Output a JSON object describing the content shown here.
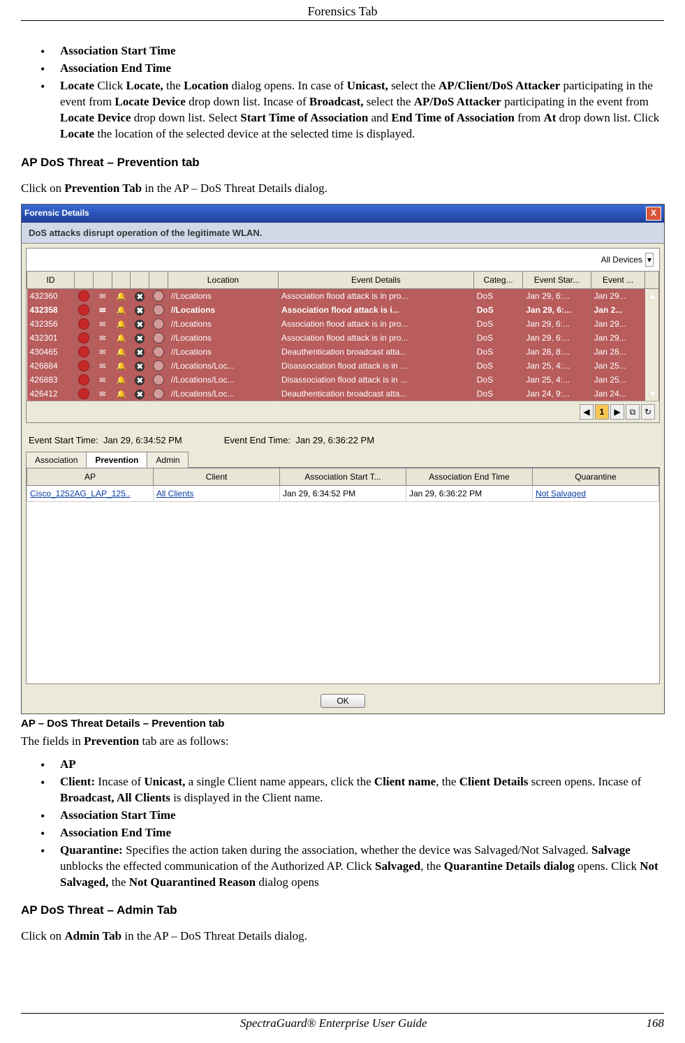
{
  "header": {
    "title": "Forensics Tab"
  },
  "bullets_top": [
    {
      "html": "<span class='bold'>Association Start Time</span>"
    },
    {
      "html": "<span class='bold'>Association End Time</span>"
    },
    {
      "html": "<span class='bold'>Locate</span> Click <span class='bold'>Locate,</span> the <span class='bold'>Location</span> dialog opens. In case of <span class='bold'>Unicast,</span> select the <span class='bold'>AP/Client/DoS Attacker</span> participating in the event from <span class='bold'>Locate Device</span> drop down list. Incase of <span class='bold'>Broadcast,</span> select the <span class='bold'>AP/DoS Attacker</span> participating in the event from <span class='bold'>Locate Device</span> drop down list. Select <span class='bold'>Start Time of Association</span> and <span class='bold'>End Time of Association</span> from <span class='bold'>At</span> drop down list. Click <span class='bold'>Locate</span> the location of the selected device at the selected time is displayed."
    }
  ],
  "section1": {
    "heading": "AP DoS Threat – Prevention tab",
    "lead_html": "Click on <span class='bold'>Prevention Tab</span> in the AP – DoS Threat Details dialog."
  },
  "dialog": {
    "title": "Forensic Details",
    "close": "X",
    "strip": "DoS attacks disrupt operation of the legitimate WLAN.",
    "filter_label": "All Devices",
    "columns": [
      "ID",
      "",
      "",
      "",
      "",
      "",
      "Location",
      "Event Details",
      "Categ...",
      "Event Star...",
      "Event ..."
    ],
    "rows": [
      {
        "id": "432360",
        "loc": "//Locations",
        "ev": "Association flood attack is in pro...",
        "cat": "DoS",
        "st": "Jan 29, 6:...",
        "en": "Jan 29...",
        "bold": false
      },
      {
        "id": "432358",
        "loc": "//Locations",
        "ev": "Association flood attack is i...",
        "cat": "DoS",
        "st": "Jan 29, 6:...",
        "en": "Jan 2...",
        "bold": true
      },
      {
        "id": "432356",
        "loc": "//Locations",
        "ev": "Association flood attack is in pro...",
        "cat": "DoS",
        "st": "Jan 29, 6:...",
        "en": "Jan 29...",
        "bold": false
      },
      {
        "id": "432301",
        "loc": "//Locations",
        "ev": "Association flood attack is in pro...",
        "cat": "DoS",
        "st": "Jan 29, 6:...",
        "en": "Jan 29...",
        "bold": false
      },
      {
        "id": "430465",
        "loc": "//Locations",
        "ev": "Deauthentication broadcast atta...",
        "cat": "DoS",
        "st": "Jan 28, 8:...",
        "en": "Jan 28...",
        "bold": false
      },
      {
        "id": "426884",
        "loc": "//Locations/Loc...",
        "ev": "Disassociation flood attack is in ...",
        "cat": "DoS",
        "st": "Jan 25, 4:...",
        "en": "Jan 25...",
        "bold": false
      },
      {
        "id": "426883",
        "loc": "//Locations/Loc...",
        "ev": "Disassociation flood attack is in ...",
        "cat": "DoS",
        "st": "Jan 25, 4:...",
        "en": "Jan 25...",
        "bold": false
      },
      {
        "id": "426412",
        "loc": "//Locations/Loc...",
        "ev": "Deauthentication broadcast atta...",
        "cat": "DoS",
        "st": "Jan 24, 9:...",
        "en": "Jan 24...",
        "bold": false
      }
    ],
    "pager": {
      "prev": "◀",
      "page": "1",
      "next": "▶"
    },
    "times": {
      "start_label": "Event Start Time:",
      "start_val": "Jan 29, 6:34:52 PM",
      "end_label": "Event End Time:",
      "end_val": "Jan 29, 6:36:22 PM"
    },
    "tabs": [
      "Association",
      "Prevention",
      "Admin"
    ],
    "active_tab": 1,
    "sub_columns": [
      "AP",
      "Client",
      "Association Start T...",
      "Association End Time",
      "Quarantine"
    ],
    "sub_row": {
      "ap": "Cisco_1252AG_LAP_125..",
      "client": "All Clients",
      "ast": "Jan 29, 6:34:52 PM",
      "aen": "Jan 29, 6:36:22 PM",
      "q": "Not Salvaged"
    },
    "ok": "OK"
  },
  "caption": "AP – DoS Threat Details – Prevention tab",
  "after_caption_html": "The fields in <span class='bold'>Prevention</span> tab are as follows:",
  "bullets_bottom": [
    {
      "html": "<span class='bold'>AP</span>"
    },
    {
      "html": "<span class='bold'>Client:</span> Incase of <span class='bold'>Unicast,</span> a single Client name appears, click the <span class='bold'>Client name</span>, the <span class='bold'>Client Details</span> screen opens. Incase of <span class='bold'>Broadcast, All Clients</span> is displayed in the Client name."
    },
    {
      "html": "<span class='bold'>Association Start Time</span>"
    },
    {
      "html": "<span class='bold'>Association End Time</span>"
    },
    {
      "html": "<span class='bold'>Quarantine:</span> Specifies the action taken during the association, whether the device was Salvaged/Not Salvaged. <span class='bold'>Salvage</span> unblocks the effected communication of the Authorized AP. Click <span class='bold'>Salvaged</span>, the <span class='bold'>Quarantine Details dialog</span> opens. Click <span class='bold'>Not Salvaged,</span> the <span class='bold'>Not Quarantined Reason</span> dialog opens"
    }
  ],
  "section2": {
    "heading": "AP DoS Threat – Admin Tab",
    "lead_html": "Click on <span class='bold'>Admin Tab</span> in the AP – DoS Threat Details dialog."
  },
  "footer": {
    "book": "SpectraGuard®  Enterprise User Guide",
    "page": "168"
  }
}
